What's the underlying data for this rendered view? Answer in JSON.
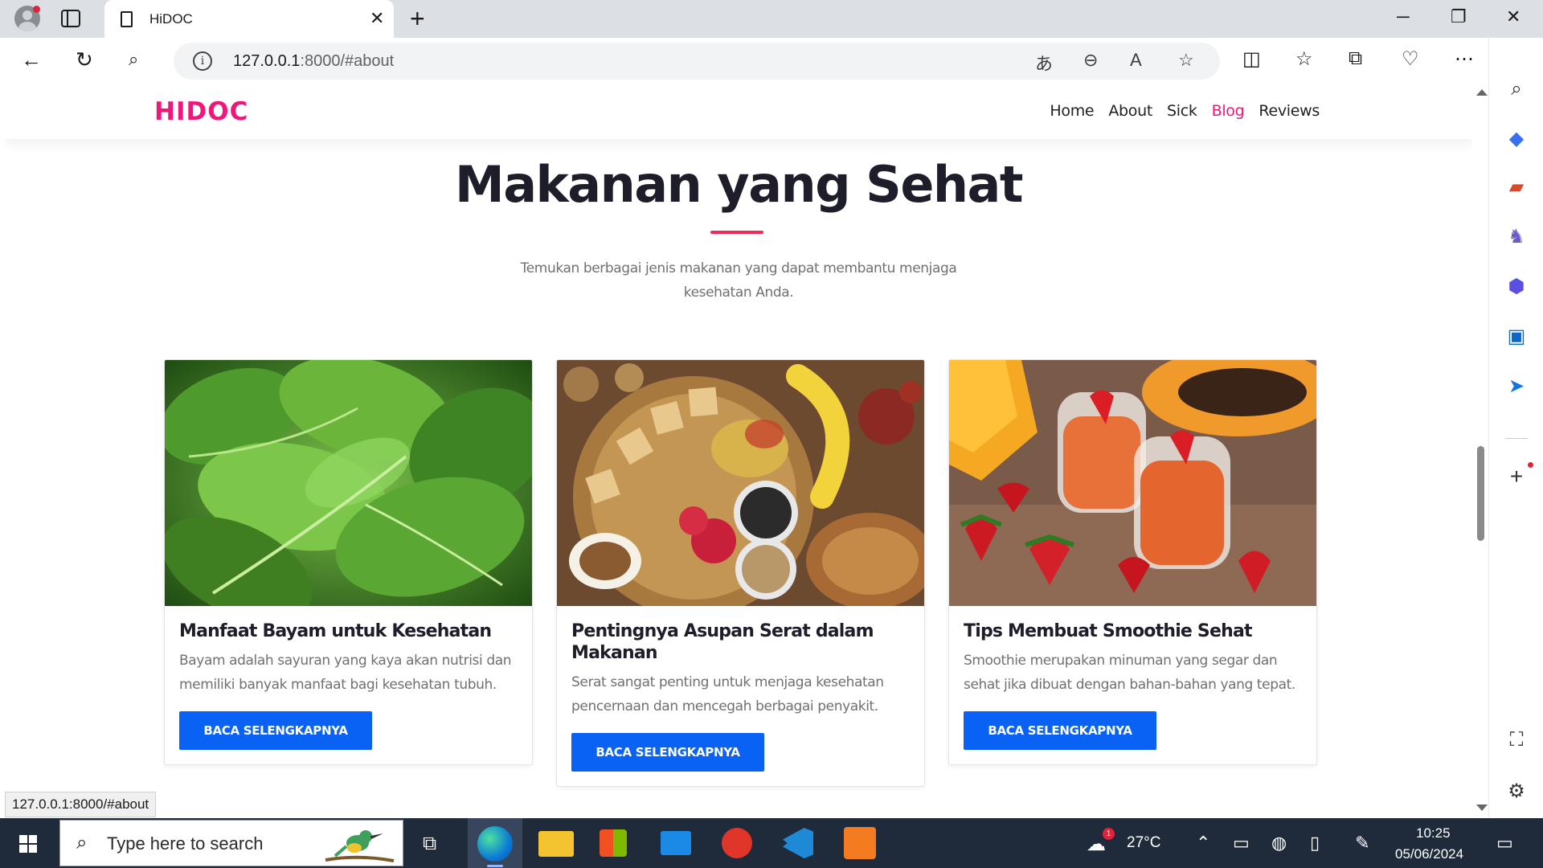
{
  "browser": {
    "tab_title": "HiDOC",
    "url_host": "127.0.0.1",
    "url_path": ":8000/#about",
    "status_url": "127.0.0.1:8000/#about"
  },
  "site": {
    "logo": "HIDOC",
    "nav": [
      "Home",
      "About",
      "Sick",
      "Blog",
      "Reviews"
    ],
    "active_nav": "Blog",
    "accent_color": "#f0167a",
    "button_color": "#0a62f5"
  },
  "section": {
    "title": "Makanan yang Sehat",
    "subtitle_line1": "Temukan berbagai jenis makanan yang dapat membantu menjaga",
    "subtitle_line2": "kesehatan Anda."
  },
  "cards": [
    {
      "title": "Manfaat Bayam untuk Kesehatan",
      "text": "Bayam adalah sayuran yang kaya akan nutrisi dan memiliki banyak manfaat bagi kesehatan tubuh.",
      "button": "BACA SELENGKAPNYA"
    },
    {
      "title": "Pentingnya Asupan Serat dalam Makanan",
      "text": "Serat sangat penting untuk menjaga kesehatan pencernaan dan mencegah berbagai penyakit.",
      "button": "BACA SELENGKAPNYA"
    },
    {
      "title": "Tips Membuat Smoothie Sehat",
      "text": "Smoothie merupakan minuman yang segar dan sehat jika dibuat dengan bahan-bahan yang tepat.",
      "button": "BACA SELENGKAPNYA"
    }
  ],
  "taskbar": {
    "search_placeholder": "Type here to search",
    "weather": "27°C",
    "weather_badge": "1",
    "time": "10:25",
    "date": "05/06/2024"
  }
}
